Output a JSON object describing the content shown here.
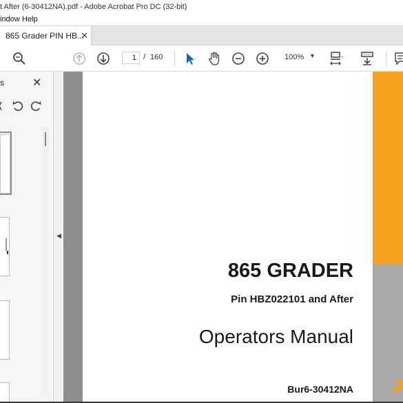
{
  "window": {
    "title": "t After (6-30412NA).pdf - Adobe Acrobat Pro DC (32-bit)"
  },
  "menu": {
    "items": [
      "indow",
      "Help"
    ]
  },
  "tab": {
    "label": "865 Grader PIN HB...",
    "close_glyph": "✕"
  },
  "toolbar": {
    "page_current": "1",
    "page_separator": "/",
    "page_total": "160",
    "zoom": "100%",
    "zoom_caret": "▼",
    "icons": [
      "search-icon",
      "prev-page-icon",
      "next-page-icon",
      "select-arrow-icon",
      "hand-icon",
      "zoom-out-icon",
      "zoom-in-icon",
      "page-fit-icon",
      "scroll-mode-icon",
      "comment-icon"
    ]
  },
  "left_panel": {
    "title": "s",
    "close_glyph": "✕",
    "collapse_glyph": "◀"
  },
  "document": {
    "title": "865 GRADER",
    "pin": "Pin HBZ022101 and After",
    "subtitle": "Operators Manual",
    "code": "Bur6-30412NA"
  },
  "colors": {
    "orange_band": "#f5a11f",
    "gray_band": "#a9a9a9",
    "select_tool_blue": "#1565c0",
    "doc_background": "#8e8e8e"
  }
}
